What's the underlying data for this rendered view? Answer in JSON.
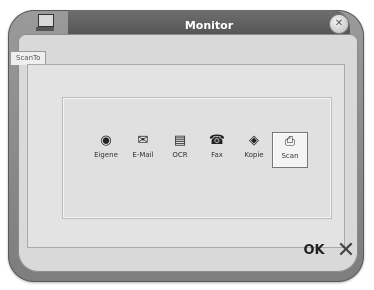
{
  "window": {
    "title": "Monitor"
  },
  "tabs": [
    {
      "label": "ScanTo"
    }
  ],
  "toolbar": {
    "items": [
      {
        "label": "Eigene",
        "icon": "eigene-icon"
      },
      {
        "label": "E-Mail",
        "icon": "email-icon"
      },
      {
        "label": "OCR",
        "icon": "ocr-icon"
      },
      {
        "label": "Fax",
        "icon": "fax-icon"
      },
      {
        "label": "Kopie",
        "icon": "kopie-icon"
      },
      {
        "label": "Scan",
        "icon": "scan-icon",
        "selected": true
      }
    ]
  },
  "footer": {
    "ok_label": "OK",
    "cancel_glyph": "✕"
  }
}
